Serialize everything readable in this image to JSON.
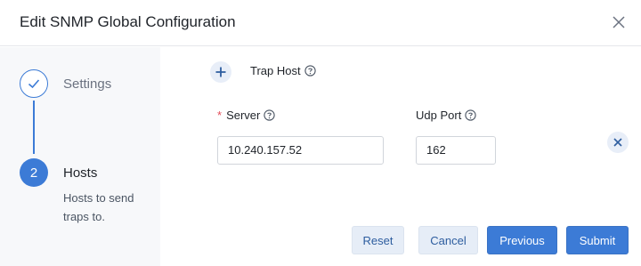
{
  "dialog": {
    "title": "Edit SNMP Global Configuration"
  },
  "stepper": {
    "steps": [
      {
        "label": "Settings",
        "state": "completed"
      },
      {
        "label": "Hosts",
        "number": "2",
        "description": "Hosts to send traps to.",
        "state": "active"
      }
    ]
  },
  "trap_host": {
    "section_title": "Trap Host",
    "server_label": "Server",
    "required_marker": "*",
    "udp_port_label": "Udp Port",
    "server_value": "10.240.157.52",
    "udp_port_value": "162"
  },
  "footer": {
    "reset_label": "Reset",
    "cancel_label": "Cancel",
    "previous_label": "Previous",
    "submit_label": "Submit"
  },
  "colors": {
    "accent": "#3c7bd6",
    "required": "#e34d59",
    "stepper_background": "#f7f8fa"
  },
  "icons": {
    "close": "close-icon",
    "step_done": "check-icon",
    "add": "plus-icon",
    "remove": "x-icon",
    "help": "question-circle-icon"
  }
}
